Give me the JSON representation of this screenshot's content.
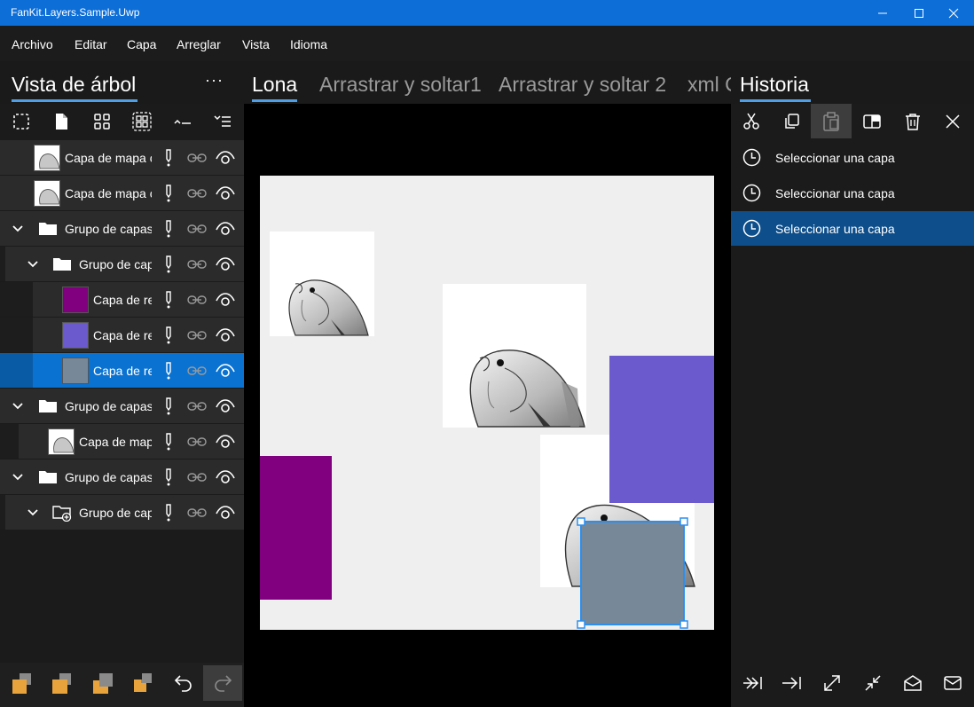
{
  "window": {
    "title": "FanKit.Layers.Sample.Uwp"
  },
  "menu": [
    "Archivo",
    "Editar",
    "Capa",
    "Arreglar",
    "Vista",
    "Idioma"
  ],
  "left_panel": {
    "title": "Vista de árbol",
    "more": "···"
  },
  "tabs": [
    "Lona",
    "Arrastrar y soltar1",
    "Arrastrar y soltar 2",
    "xml C"
  ],
  "right_panel": {
    "title": "Historia"
  },
  "layers": [
    {
      "label": "Capa de mapa c",
      "type": "bitmap"
    },
    {
      "label": "Capa de mapa c",
      "type": "bitmap"
    },
    {
      "label": "Grupo de capas",
      "type": "group"
    },
    {
      "label": "Grupo de cap",
      "type": "group"
    },
    {
      "label": "Capa de re",
      "type": "fill",
      "color": "#800080"
    },
    {
      "label": "Capa de re",
      "type": "fill",
      "color": "#6a5acd"
    },
    {
      "label": "Capa de re",
      "type": "fill",
      "color": "#778899"
    },
    {
      "label": "Grupo de capas",
      "type": "group"
    },
    {
      "label": "Capa de map",
      "type": "bitmap"
    },
    {
      "label": "Grupo de capas",
      "type": "group"
    },
    {
      "label": "Grupo de cap",
      "type": "group-add"
    }
  ],
  "history": [
    "Seleccionar una capa",
    "Seleccionar una capa",
    "Seleccionar una capa"
  ],
  "colors": {
    "titlebar": "#0d6ed8",
    "selection": "#0a72d1",
    "accent": "#4f9fe6",
    "purple": "#800080",
    "slateblue": "#6a5acd",
    "slategray": "#778899"
  }
}
